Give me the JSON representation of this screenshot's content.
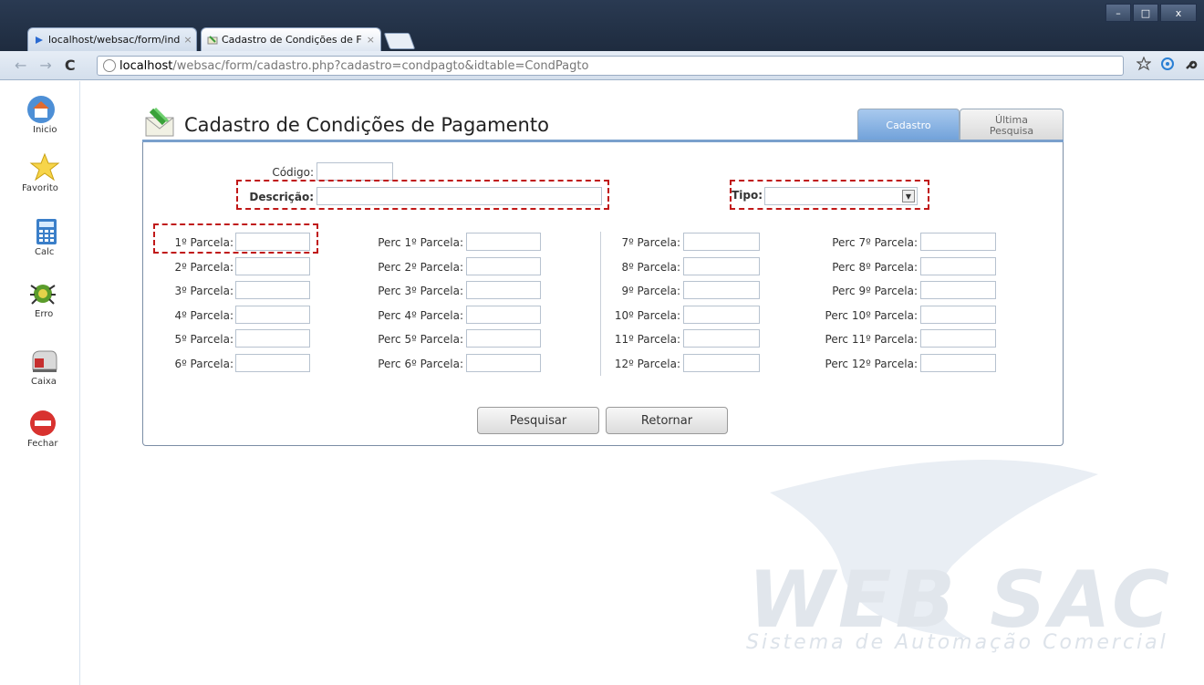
{
  "browser": {
    "tabs": [
      {
        "title": "localhost/websac/form/ind",
        "close": "×"
      },
      {
        "title": "Cadastro de Condições de F",
        "close": "×"
      }
    ],
    "url_host": "localhost",
    "url_path": "/websac/form/cadastro.php?cadastro=condpagto&idtable=CondPagto",
    "window_controls": {
      "minimize": "–",
      "maximize": "□",
      "close": "x"
    },
    "nav": {
      "back": "←",
      "forward": "→",
      "reload": "C"
    },
    "toolbar_icons": [
      "star-icon",
      "rss-icon",
      "wrench-icon"
    ]
  },
  "sidebar": {
    "items": [
      {
        "label": "Inicio",
        "icon": "home-icon"
      },
      {
        "label": "Favorito",
        "icon": "star-icon"
      },
      {
        "label": "Calc",
        "icon": "calculator-icon"
      },
      {
        "label": "Erro",
        "icon": "bug-icon"
      },
      {
        "label": "Caixa",
        "icon": "mailbox-icon"
      },
      {
        "label": "Fechar",
        "icon": "close-icon"
      }
    ]
  },
  "header": {
    "title": "Cadastro de Condições de Pagamento",
    "tab_cadastro": "Cadastro",
    "tab_ultima_line1": "Última",
    "tab_ultima_line2": "Pesquisa"
  },
  "form": {
    "codigo_label": "Código:",
    "descricao_label": "Descrição:",
    "tipo_label": "Tipo:",
    "parcelas_left": [
      {
        "label": "1º Parcela:",
        "perc": "Perc 1º Parcela:"
      },
      {
        "label": "2º Parcela:",
        "perc": "Perc 2º Parcela:"
      },
      {
        "label": "3º Parcela:",
        "perc": "Perc 3º Parcela:"
      },
      {
        "label": "4º Parcela:",
        "perc": "Perc 4º Parcela:"
      },
      {
        "label": "5º Parcela:",
        "perc": "Perc 5º Parcela:"
      },
      {
        "label": "6º Parcela:",
        "perc": "Perc 6º Parcela:"
      }
    ],
    "parcelas_right": [
      {
        "label": "7º Parcela:",
        "perc": "Perc 7º Parcela:"
      },
      {
        "label": "8º Parcela:",
        "perc": "Perc 8º Parcela:"
      },
      {
        "label": "9º Parcela:",
        "perc": "Perc 9º Parcela:"
      },
      {
        "label": "10º Parcela:",
        "perc": "Perc 10º Parcela:"
      },
      {
        "label": "11º Parcela:",
        "perc": "Perc 11º Parcela:"
      },
      {
        "label": "12º Parcela:",
        "perc": "Perc 12º Parcela:"
      }
    ],
    "btn_pesquisar": "Pesquisar",
    "btn_retornar": "Retornar"
  },
  "watermark": {
    "title": "WEB SAC",
    "subtitle": "Sistema de Automação Comercial"
  },
  "colors": {
    "accent": "#6fa0d9",
    "highlight": "#c01818"
  }
}
